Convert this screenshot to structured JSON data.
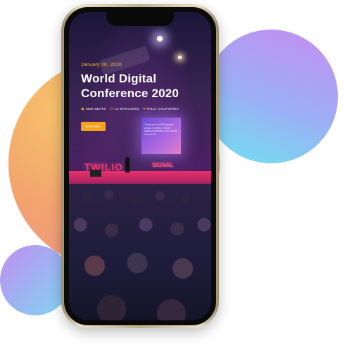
{
  "hero": {
    "date": "January 20, 2020",
    "title_line1": "World Digital",
    "title_line2": "Conference 2020",
    "meta": [
      {
        "icon": "person-icon",
        "glyph": "♟",
        "text": "5000 SEATS"
      },
      {
        "icon": "mic-icon",
        "glyph": "☐",
        "text": "12 SPEACERS"
      },
      {
        "icon": "location-pin-icon",
        "glyph": "●",
        "text": "PALO, CALIFORNIA"
      }
    ],
    "cta_label": "Book Now"
  },
  "stage": {
    "screen_text": "Today we're 40,000 people across 5 offices, 35,000 paying customers, and valued at over $1...",
    "letters_left": "TWILIO",
    "letters_right": "SIGNAL"
  },
  "colors": {
    "accent": "#f5a21c",
    "date_color": "#f5b52b",
    "blob_orange": "#f2a46e",
    "blob_purple": "#c58cf2",
    "blob_cyan": "#7fd6f3"
  }
}
